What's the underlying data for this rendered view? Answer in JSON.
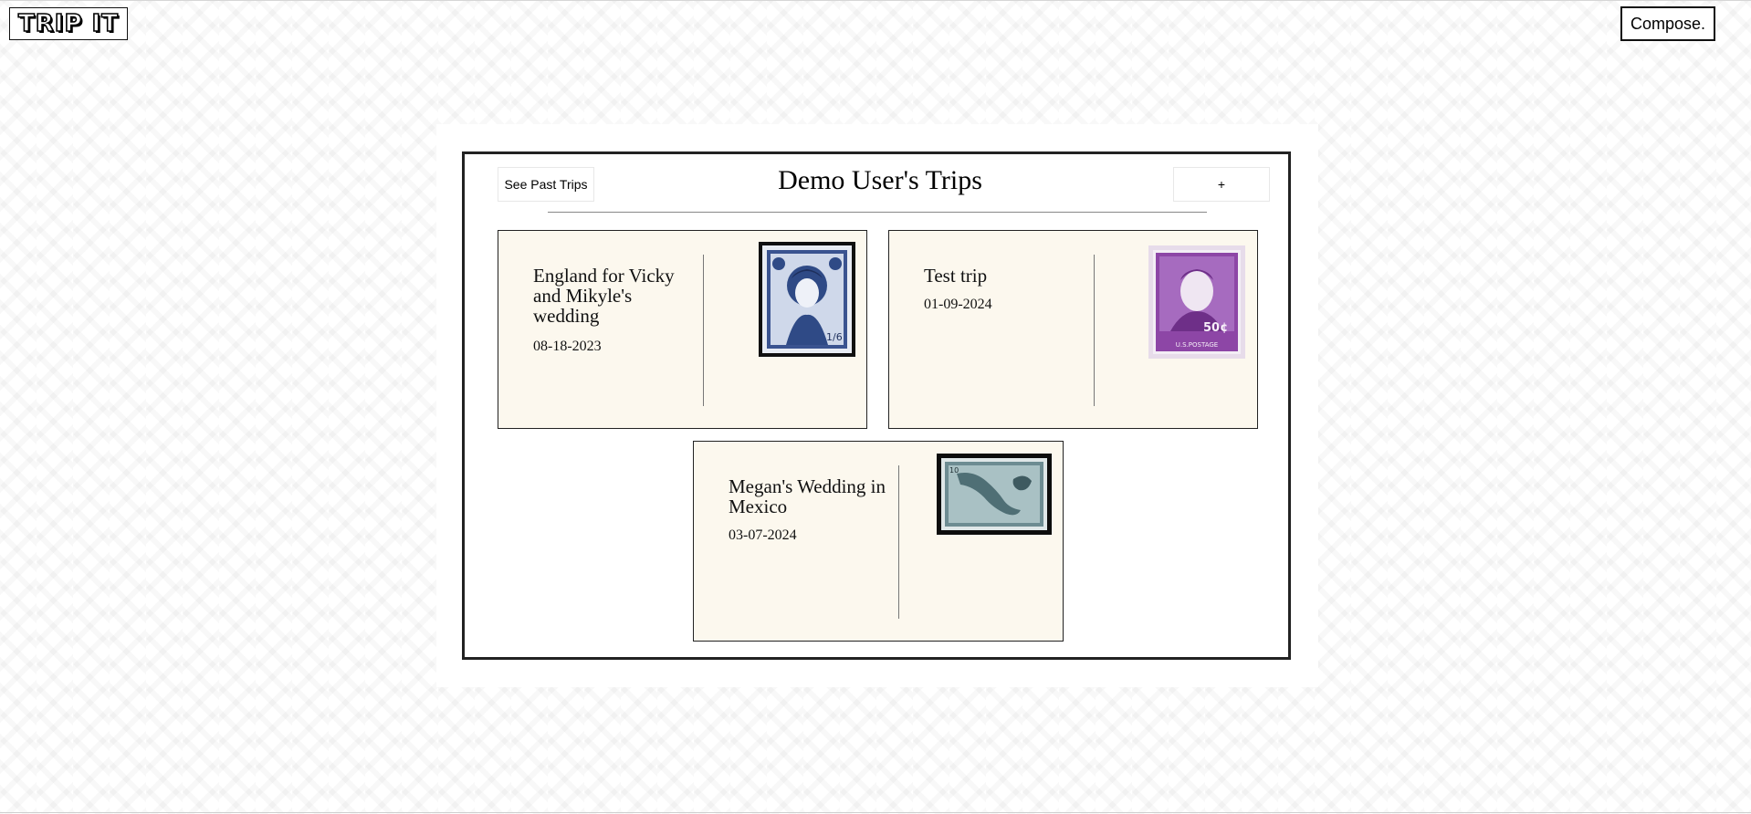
{
  "header": {
    "logo_text": "TRIP IT",
    "compose_label": "Compose."
  },
  "board": {
    "title": "Demo User's Trips",
    "past_trips_label": "See Past Trips",
    "add_label": "+"
  },
  "trips": [
    {
      "title": "England for Vicky and Mikyle's wedding",
      "date": "08-18-2023",
      "stamp": "queen-stamp-icon",
      "stamp_value": "1/6"
    },
    {
      "title": "Test trip",
      "date": "01-09-2024",
      "stamp": "us-50c-stamp-icon",
      "stamp_value": "50¢",
      "stamp_caption": "U.S.POSTAGE"
    },
    {
      "title": "Megan's Wedding in Mexico",
      "date": "03-07-2024",
      "stamp": "mexico-map-stamp-icon",
      "stamp_value": "10"
    }
  ],
  "colors": {
    "card_bg": "#fcf8ee",
    "stamp_blue": "#2f4a86",
    "stamp_purple": "#8d46a6",
    "stamp_teal": "#4f6f75"
  }
}
